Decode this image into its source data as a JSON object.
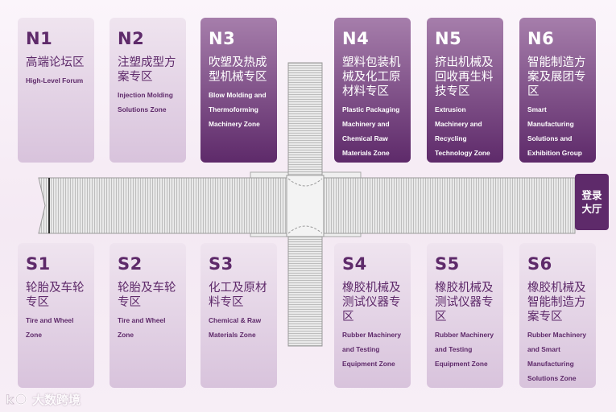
{
  "north_halls": [
    {
      "code": "N1",
      "name_cn": "高端论坛区",
      "name_en": "High-Level Forum",
      "style": "light"
    },
    {
      "code": "N2",
      "name_cn": "注塑成型方案专区",
      "name_en": "Injection Molding Solutions Zone",
      "style": "light"
    },
    {
      "code": "N3",
      "name_cn": "吹塑及热成型机械专区",
      "name_en": "Blow Molding and Thermoforming Machinery Zone",
      "style": "dark"
    },
    {
      "code": "N4",
      "name_cn": "塑料包装机械及化工原材料专区",
      "name_en": "Plastic Packaging Machinery and Chemical Raw Materials Zone",
      "style": "dark"
    },
    {
      "code": "N5",
      "name_cn": "挤出机械及回收再生料技专区",
      "name_en": "Extrusion Machinery and Recycling Technology Zone",
      "style": "dark"
    },
    {
      "code": "N6",
      "name_cn": "智能制造方案及展团专区",
      "name_en": "Smart Manufacturing Solutions and Exhibition Group",
      "style": "dark"
    }
  ],
  "south_halls": [
    {
      "code": "S1",
      "name_cn": "轮胎及车轮专区",
      "name_en": "Tire and Wheel Zone",
      "style": "light"
    },
    {
      "code": "S2",
      "name_cn": "轮胎及车轮专区",
      "name_en": "Tire and Wheel Zone",
      "style": "light"
    },
    {
      "code": "S3",
      "name_cn": "化工及原材料专区",
      "name_en": "Chemical & Raw Materials Zone",
      "style": "light"
    },
    {
      "code": "S4",
      "name_cn": "橡胶机械及测试仪器专区",
      "name_en": "Rubber Machinery and Testing Equipment Zone",
      "style": "light"
    },
    {
      "code": "S5",
      "name_cn": "橡胶机械及测试仪器专区",
      "name_en": "Rubber Machinery and Testing Equipment Zone",
      "style": "light"
    },
    {
      "code": "S6",
      "name_cn": "橡胶机械及智能制造方案专区",
      "name_en": "Rubber Machinery and Smart Manufacturing Solutions Zone",
      "style": "light"
    }
  ],
  "lobby": {
    "label": "登录大厅"
  },
  "watermark": {
    "text": "大数跨境"
  },
  "colors": {
    "accent": "#5e2a6a",
    "light_hall": "#d8c3dc",
    "dark_hall": "#5e2a6a",
    "corridor": "#e4e4e4"
  }
}
